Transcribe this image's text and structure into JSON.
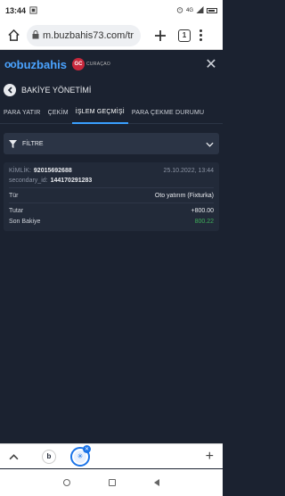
{
  "status_bar": {
    "time": "13:44",
    "notification_icon": "screenshot-icon",
    "network": "4G",
    "icons": [
      "alarm-icon",
      "signal-icon",
      "battery-icon"
    ]
  },
  "browser": {
    "url": "m.buzbahis73.com/tr",
    "tab_count": "1",
    "icons": [
      "home-icon",
      "lock-icon",
      "plus-icon",
      "tabs-icon",
      "menu-icon"
    ]
  },
  "site": {
    "logo_prefix": "oo",
    "logo_text": "buzbahis",
    "gc_badge": "GC",
    "gc_text": "CURAÇAO"
  },
  "page": {
    "title": "BAKİYE YÖNETİMİ"
  },
  "tabs": [
    {
      "label": "PARA YATIR",
      "active": false
    },
    {
      "label": "ÇEKİM",
      "active": false
    },
    {
      "label": "İŞLEM GEÇMİŞİ",
      "active": true
    },
    {
      "label": "PARA ÇEKME DURUMU",
      "active": false
    }
  ],
  "filter": {
    "label": "FİLTRE"
  },
  "transaction": {
    "id_label": "KİMLİK:",
    "id_value": "92015692688",
    "date": "25.10.2022, 13:44",
    "secondary_label": "secondary_id:",
    "secondary_value": "144170291283",
    "type_label": "Tür",
    "type_value": "Oto yatırım (Fixturka)",
    "amount_label": "Tutar",
    "amount_value": "+800.00",
    "balance_label": "Son Bakiye",
    "balance_value": "800.22"
  },
  "bottom_bar": {
    "tab_b_letter": "b",
    "tab_active_icon": "snowflake-icon"
  },
  "colors": {
    "background": "#1b2230",
    "card": "#222a39",
    "accent": "#3aa0ff",
    "positive": "#3fae5a"
  }
}
